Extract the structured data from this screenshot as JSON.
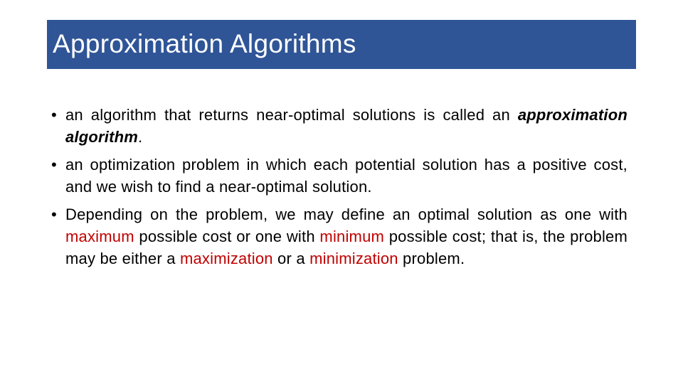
{
  "slide": {
    "title": "Approximation Algorithms",
    "colors": {
      "title_bg": "#2f5597",
      "title_text": "#ffffff",
      "highlight": "#c00000"
    },
    "bullets": [
      {
        "part1": "an algorithm that returns near-optimal solutions is called an ",
        "emphasis": "approximation algorithm",
        "part2": "."
      },
      {
        "text": "an optimization problem in which each potential solution has a positive cost, and we wish to find a near-optimal solution."
      },
      {
        "t1": "Depending on the problem, we may define an optimal solution as one with ",
        "r1": "maximum",
        "t2": " possible cost or one with ",
        "r2": "minimum",
        "t3": " possible cost; that is, the problem may be either a ",
        "r3": "maximization",
        "t4": " or a ",
        "r4": "minimization",
        "t5": " problem."
      }
    ]
  }
}
